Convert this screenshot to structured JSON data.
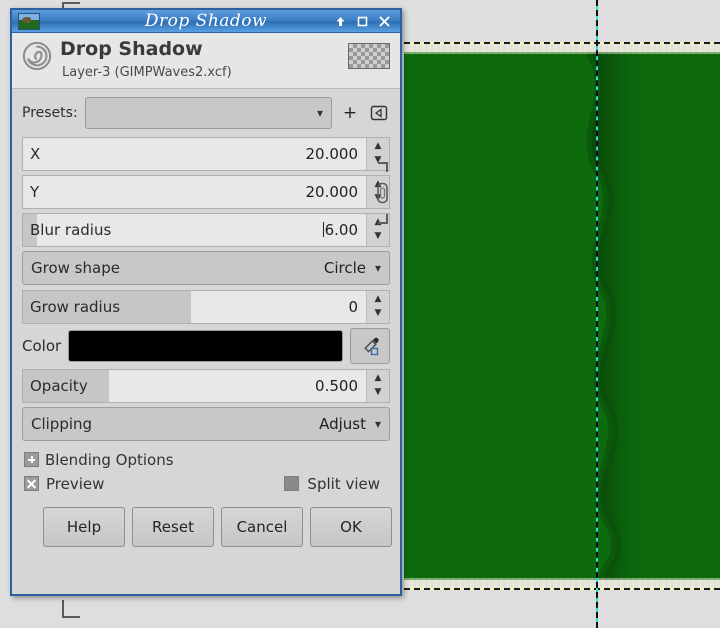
{
  "window": {
    "title": "Drop Shadow",
    "icon": "gimp-image-icon",
    "controls": [
      {
        "name": "shade-button",
        "glyph": "shade-up-icon"
      },
      {
        "name": "maximize-button",
        "glyph": "maximize-icon"
      },
      {
        "name": "close-button",
        "glyph": "close-icon"
      }
    ]
  },
  "header": {
    "operation_title": "Drop Shadow",
    "subtitle": "Layer-3 (GIMPWaves2.xcf)",
    "operation_icon": "gegl-spiral-icon",
    "thumbnail": "checkerboard-thumbnail"
  },
  "presets": {
    "label": "Presets:",
    "value": "",
    "add_label": "+",
    "menu_icon": "preset-menu-icon"
  },
  "params": {
    "x": {
      "label": "X",
      "value": "20.000",
      "fill_percent": 0
    },
    "y": {
      "label": "Y",
      "value": "20.000",
      "fill_percent": 0
    },
    "blur_radius": {
      "label": "Blur radius",
      "value": "6.00",
      "fill_percent": 4,
      "focused": true
    },
    "grow_shape": {
      "label": "Grow shape",
      "value": "Circle"
    },
    "grow_radius": {
      "label": "Grow radius",
      "value": "0",
      "fill_percent": 49
    },
    "color": {
      "label": "Color",
      "value": "#000000",
      "picker_icon": "eyedropper-icon"
    },
    "opacity": {
      "label": "Opacity",
      "value": "0.500",
      "fill_percent": 25
    },
    "clipping": {
      "label": "Clipping",
      "value": "Adjust"
    },
    "link_chain": {
      "name": "chain-link-icon",
      "linked": false
    }
  },
  "options": {
    "blending_options": {
      "label": "Blending Options",
      "expanded": false
    },
    "preview": {
      "label": "Preview",
      "checked": true
    },
    "split_view": {
      "label": "Split view",
      "checked": false
    }
  },
  "buttons": [
    {
      "name": "help-button",
      "label": "Help"
    },
    {
      "name": "reset-button",
      "label": "Reset"
    },
    {
      "name": "cancel-button",
      "label": "Cancel"
    },
    {
      "name": "ok-button",
      "label": "OK"
    }
  ],
  "canvas": {
    "image_color": "#0d6b0d",
    "guide_color": "#2ae0d0",
    "layer_boundary_color": "#f5f5b0"
  }
}
